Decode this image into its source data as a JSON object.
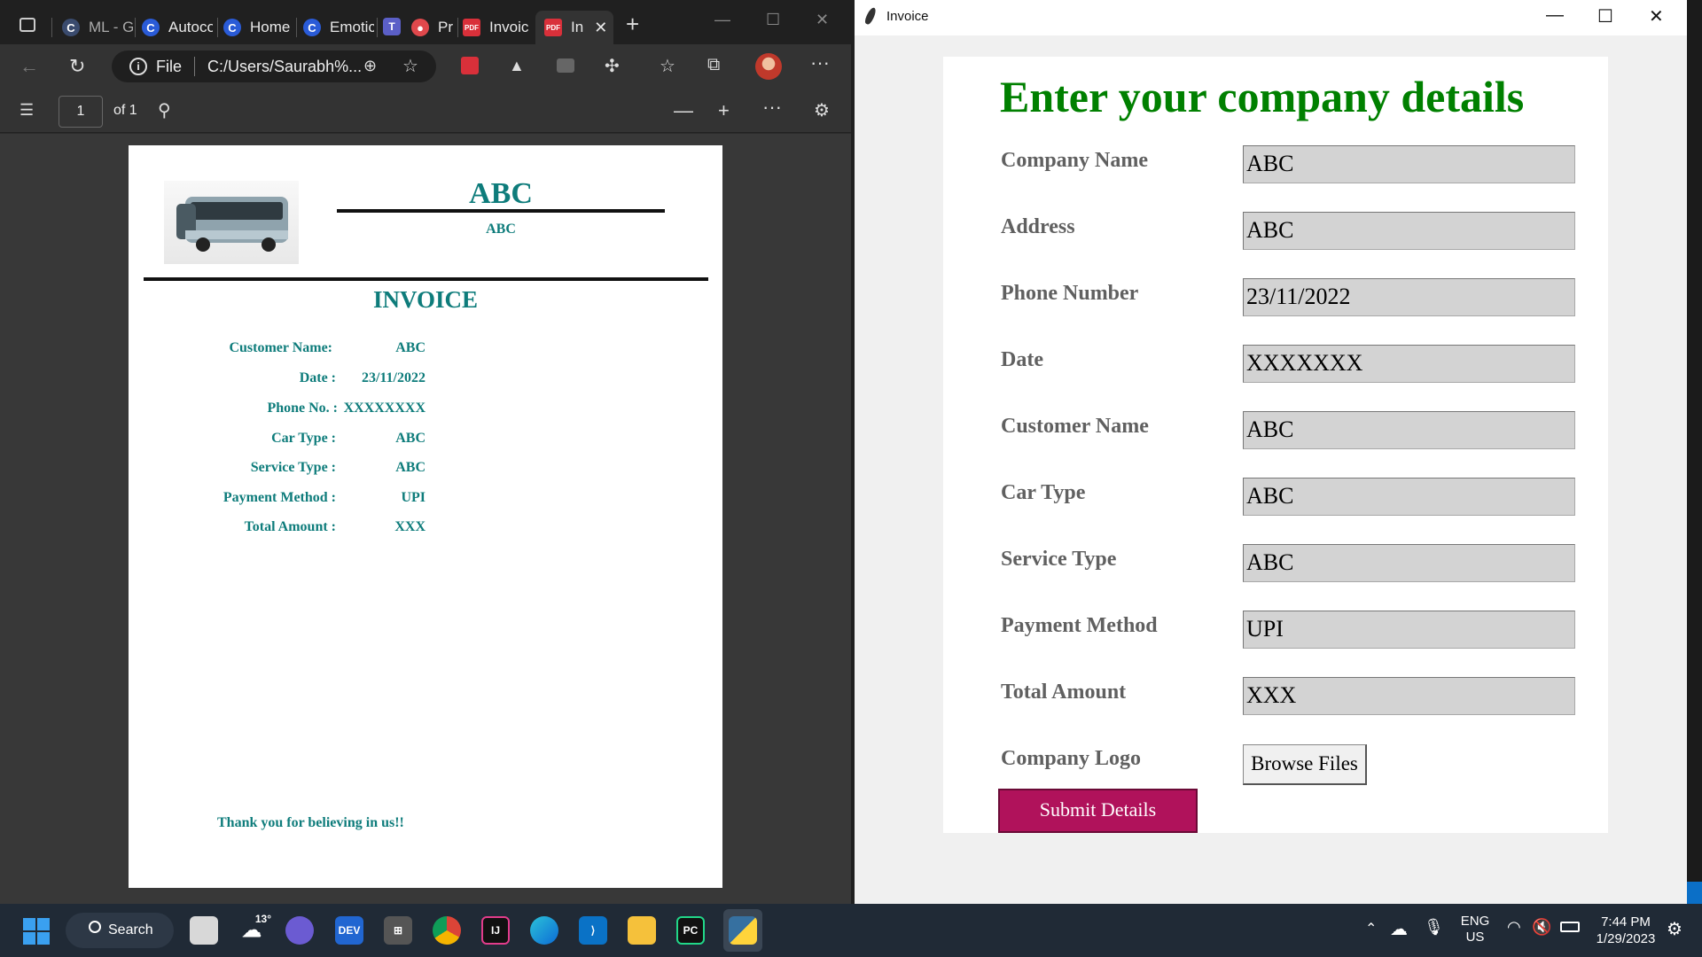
{
  "browser": {
    "tabs": [
      {
        "label": "ML - G",
        "favicon": "C"
      },
      {
        "label": "Autoco",
        "favicon": "C"
      },
      {
        "label": "Home",
        "favicon": "C"
      },
      {
        "label": "Emotic",
        "favicon": "C"
      },
      {
        "label": "Pr",
        "favicon": "●"
      },
      {
        "label": "Invoic",
        "favicon": "PDF"
      },
      {
        "label": "In",
        "favicon": "PDF"
      }
    ],
    "address": {
      "scheme_label": "File",
      "url": "C:/Users/Saurabh%..."
    },
    "pdf_toolbar": {
      "page_current": "1",
      "page_total": "of 1"
    }
  },
  "pdf": {
    "company": "ABC",
    "address": "ABC",
    "title": "INVOICE",
    "fields": [
      {
        "label": "Customer Name:",
        "value": "ABC"
      },
      {
        "label": "Date :",
        "value": "23/11/2022"
      },
      {
        "label": "Phone No. :",
        "value": "XXXXXXXX"
      },
      {
        "label": "Car Type :",
        "value": "ABC"
      },
      {
        "label": "Service Type :",
        "value": "ABC"
      },
      {
        "label": "Payment Method :",
        "value": "UPI"
      },
      {
        "label": "Total Amount :",
        "value": "XXX"
      }
    ],
    "thanks": "Thank you for believing in us!!"
  },
  "form": {
    "window_title": "Invoice",
    "heading": "Enter your company details",
    "fields": [
      {
        "label": "Company Name",
        "value": "ABC"
      },
      {
        "label": "Address",
        "value": "ABC"
      },
      {
        "label": "Phone Number",
        "value": "23/11/2022"
      },
      {
        "label": "Date",
        "value": "XXXXXXX"
      },
      {
        "label": "Customer Name",
        "value": "ABC"
      },
      {
        "label": "Car Type",
        "value": "ABC"
      },
      {
        "label": "Service Type",
        "value": "ABC"
      },
      {
        "label": "Payment Method",
        "value": "UPI"
      },
      {
        "label": "Total Amount",
        "value": "XXX"
      }
    ],
    "logo_label": "Company Logo",
    "browse_label": "Browse Files",
    "submit_label": "Submit Details",
    "accent_color": "#008000",
    "submit_color": "#b0125b"
  },
  "taskbar": {
    "search_label": "Search",
    "weather": "13°",
    "lang_line1": "ENG",
    "lang_line2": "US",
    "time": "7:44 PM",
    "date": "1/29/2023"
  }
}
